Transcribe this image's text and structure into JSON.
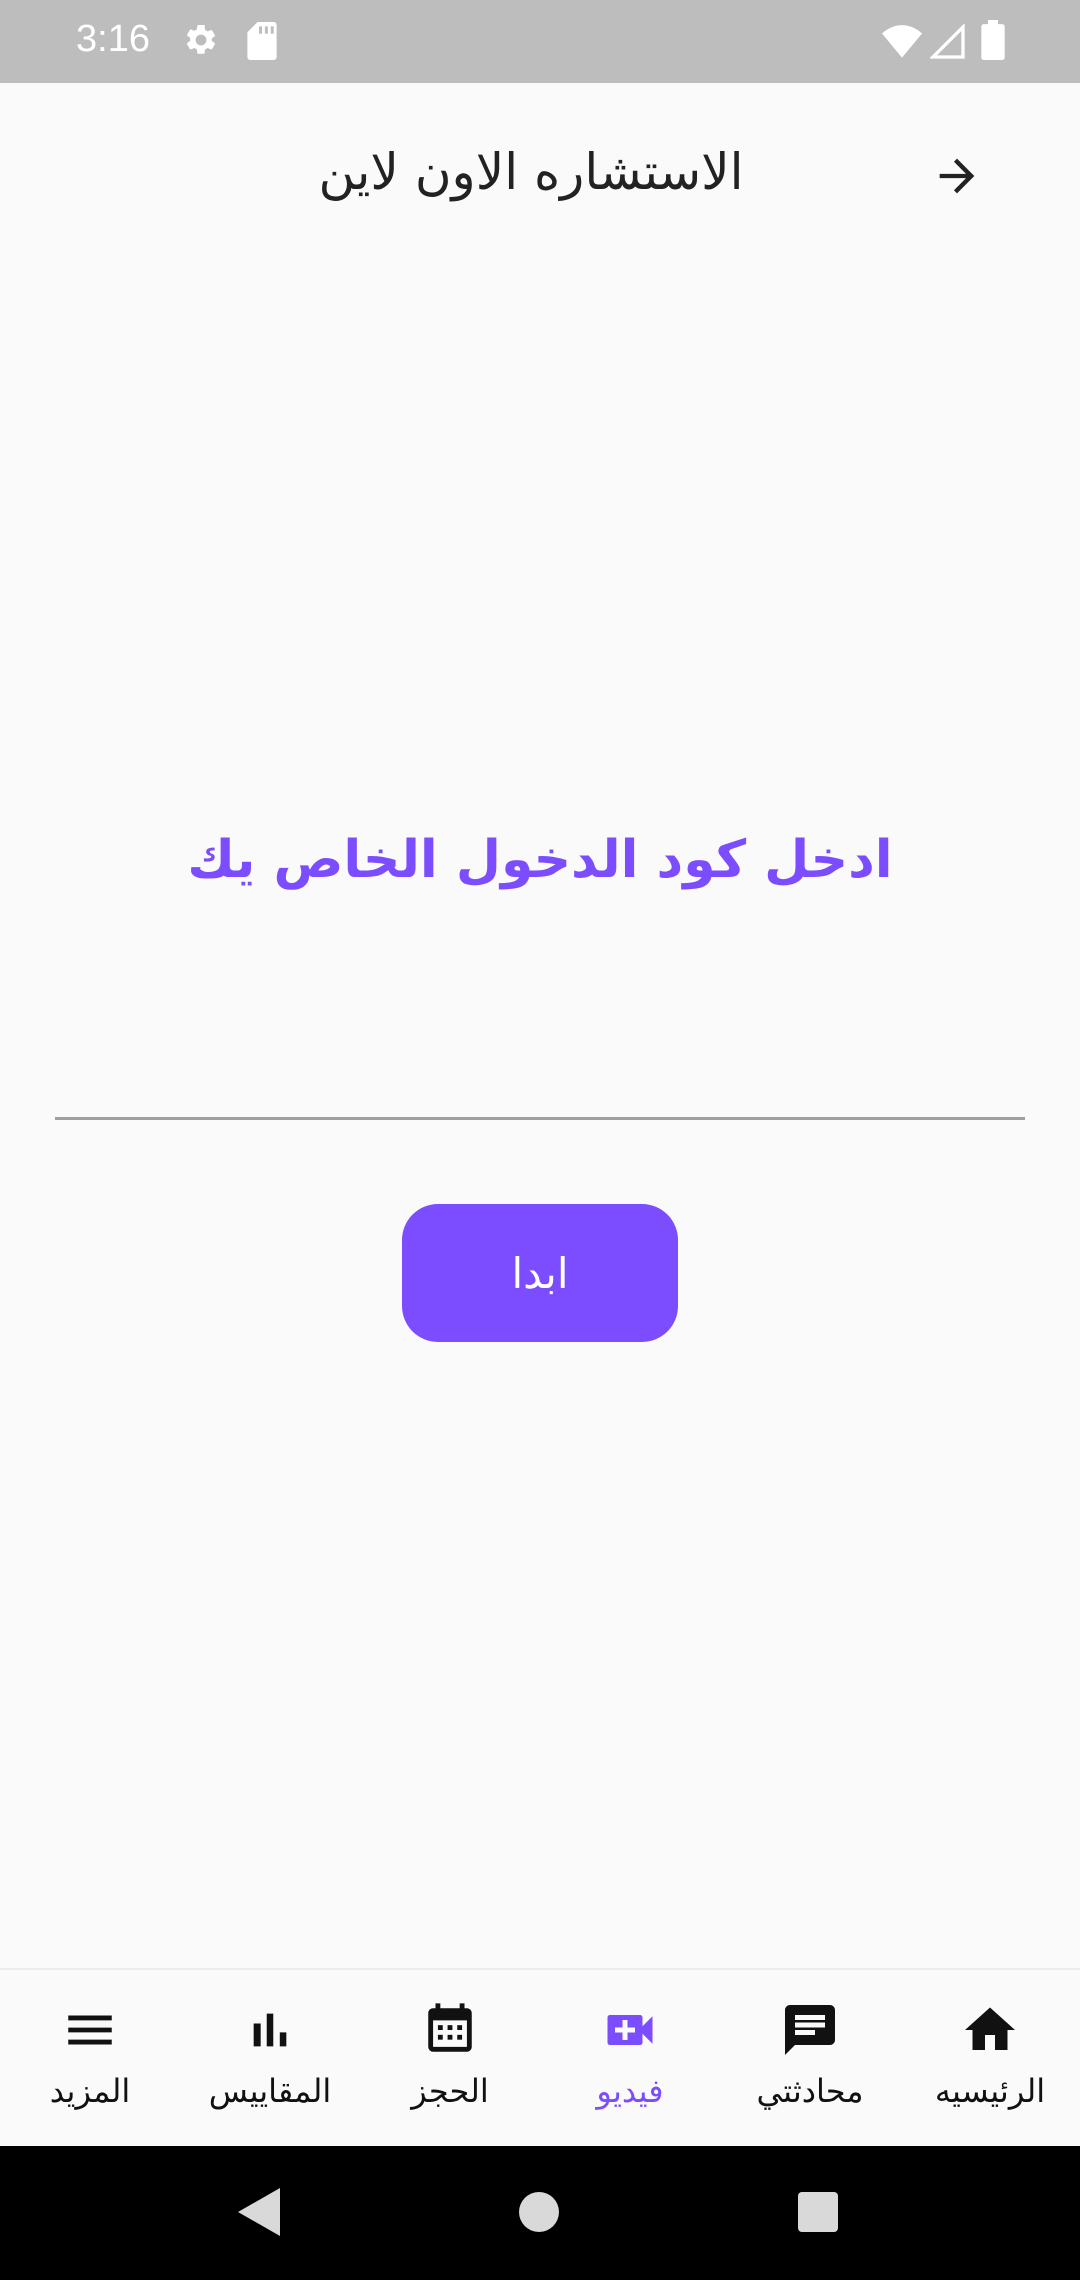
{
  "status_bar": {
    "time": "3:16",
    "icons": [
      "gear-icon",
      "sd-card-icon",
      "wifi-icon",
      "signal-icon",
      "battery-icon"
    ]
  },
  "app_bar": {
    "title": "الاستشاره الاون لاين",
    "back_icon": "arrow-right-icon"
  },
  "main": {
    "prompt": "ادخل كود الدخول الخاص يك",
    "code_input": {
      "value": "",
      "placeholder": ""
    },
    "start_button": "ابدا"
  },
  "bottom_nav": {
    "items": [
      {
        "label": "الرئيسيه",
        "icon": "home-icon",
        "active": false
      },
      {
        "label": "محادثتي",
        "icon": "chat-icon",
        "active": false
      },
      {
        "label": "فيديو",
        "icon": "video-call-icon",
        "active": true
      },
      {
        "label": "الحجز",
        "icon": "calendar-icon",
        "active": false
      },
      {
        "label": "المقاييس",
        "icon": "bar-chart-icon",
        "active": false
      },
      {
        "label": "المزيد",
        "icon": "menu-icon",
        "active": false
      }
    ]
  },
  "colors": {
    "accent": "#7c4dff",
    "status_bar": "#bdbdbd",
    "background": "#fafafa"
  }
}
